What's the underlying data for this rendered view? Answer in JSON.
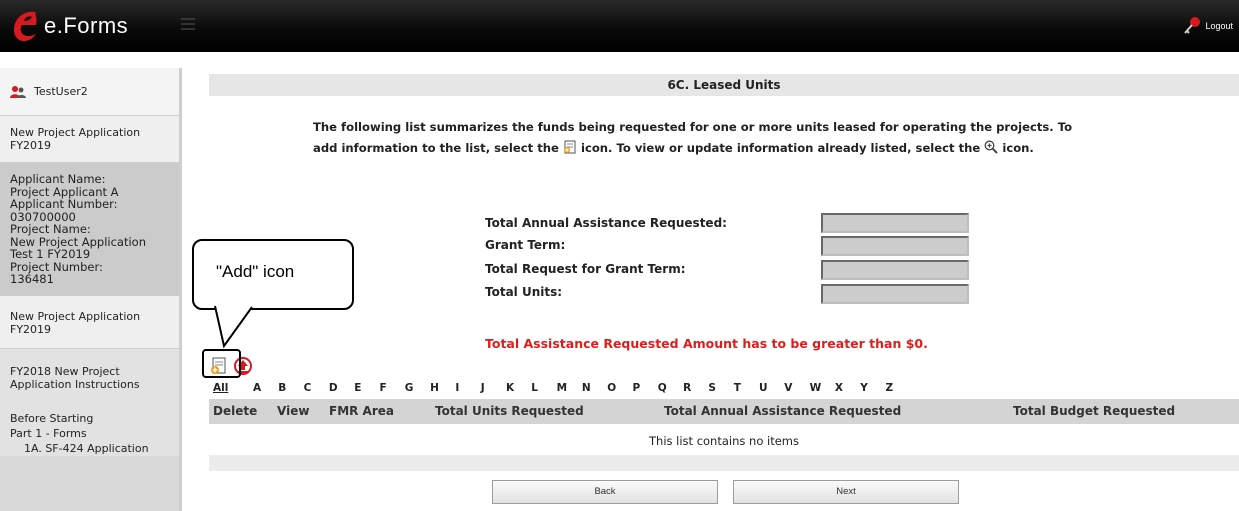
{
  "header": {
    "app_name": "e.Forms",
    "logout_label": "Logout"
  },
  "sidebar": {
    "user_name": "TestUser2",
    "app_title_line1": "New Project Application",
    "app_title_line2": "FY2019",
    "applicant_name_label": "Applicant Name:",
    "applicant_name": "Project Applicant A",
    "applicant_number_label": "Applicant Number:",
    "applicant_number": "030700000",
    "project_name_label": "Project Name:",
    "project_name_line1": "New Project Application",
    "project_name_line2": "Test 1 FY2019",
    "project_number_label": "Project Number:",
    "project_number": "136481",
    "link1_line1": "New Project Application",
    "link1_line2": "FY2019",
    "link2_line1": "FY2018 New Project",
    "link2_line2": "Application Instructions",
    "nav_before_starting": "Before Starting",
    "nav_part1": "Part 1 - Forms",
    "nav_sf424": "1A. SF-424 Application"
  },
  "main": {
    "section_title": "6C. Leased Units",
    "intro_part1": "The following list summarizes the funds being requested for one or more units leased for operating the projects. To",
    "intro_part2": "add information to the list, select the",
    "intro_part3": "icon. To view or update information already listed, select the",
    "intro_part4": "icon.",
    "summary": {
      "total_annual_label": "Total Annual Assistance Requested:",
      "grant_term_label": "Grant Term:",
      "total_request_label": "Total Request for Grant Term:",
      "total_units_label": "Total Units:",
      "total_annual_value": "",
      "grant_term_value": "",
      "total_request_value": "",
      "total_units_value": ""
    },
    "warning": "Total Assistance Requested Amount has to be greater than $0.",
    "alphabet": [
      "All",
      "A",
      "B",
      "C",
      "D",
      "E",
      "F",
      "G",
      "H",
      "I",
      "J",
      "K",
      "L",
      "M",
      "N",
      "O",
      "P",
      "Q",
      "R",
      "S",
      "T",
      "U",
      "V",
      "W",
      "X",
      "Y",
      "Z"
    ],
    "columns": [
      "Delete",
      "View",
      "FMR Area",
      "Total Units Requested",
      "Total Annual Assistance Requested",
      "Total Budget Requested"
    ],
    "empty_message": "This list contains no items",
    "back_label": "Back",
    "next_label": "Next"
  },
  "callout": {
    "text": "\"Add\" icon"
  },
  "icons": {
    "add": "add-document-icon",
    "view": "magnifier-plus-icon",
    "export": "upload-icon",
    "logo": "e-logo-icon",
    "logout": "key-icon",
    "user": "user-icon"
  },
  "colors": {
    "topbar": "#000000",
    "warning": "#e01d1d",
    "logo_red": "#d71920",
    "sidebar": "#d9d9d9",
    "header_row": "#d4d4d4"
  }
}
